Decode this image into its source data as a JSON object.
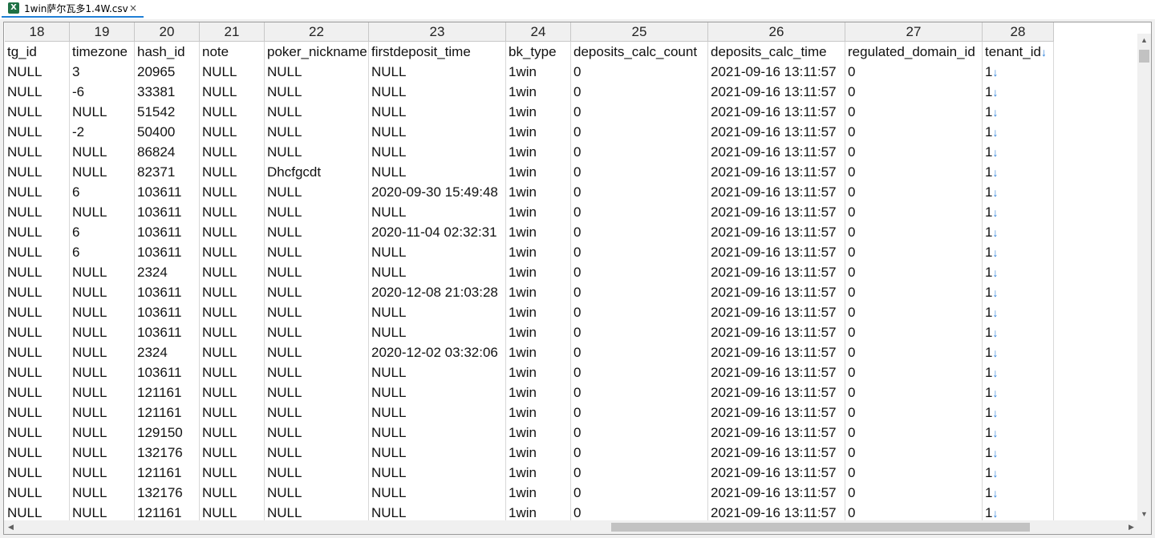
{
  "tab": {
    "title": "1win萨尔瓦多1.4W.csv",
    "close": "×",
    "icon_letter": "X",
    "icon": "excel-file-icon",
    "accent": "#1f7fd6"
  },
  "column_numbers": [
    "18",
    "19",
    "20",
    "21",
    "22",
    "23",
    "24",
    "25",
    "26",
    "27",
    "28"
  ],
  "headers": [
    "tg_id",
    "timezone",
    "hash_id",
    "note",
    "poker_nickname",
    "firstdeposit_time",
    "bk_type",
    "deposits_calc_count",
    "deposits_calc_time",
    "regulated_domain_id",
    "tenant_id"
  ],
  "rows": [
    [
      "NULL",
      "3",
      "20965",
      "NULL",
      "NULL",
      "NULL",
      "1win",
      "0",
      "2021-09-16 13:11:57",
      "0",
      "1"
    ],
    [
      "NULL",
      "-6",
      "33381",
      "NULL",
      "NULL",
      "NULL",
      "1win",
      "0",
      "2021-09-16 13:11:57",
      "0",
      "1"
    ],
    [
      "NULL",
      "NULL",
      "51542",
      "NULL",
      "NULL",
      "NULL",
      "1win",
      "0",
      "2021-09-16 13:11:57",
      "0",
      "1"
    ],
    [
      "NULL",
      "-2",
      "50400",
      "NULL",
      "NULL",
      "NULL",
      "1win",
      "0",
      "2021-09-16 13:11:57",
      "0",
      "1"
    ],
    [
      "NULL",
      "NULL",
      "86824",
      "NULL",
      "NULL",
      "NULL",
      "1win",
      "0",
      "2021-09-16 13:11:57",
      "0",
      "1"
    ],
    [
      "NULL",
      "NULL",
      "82371",
      "NULL",
      "Dhcfgcdt",
      "NULL",
      "1win",
      "0",
      "2021-09-16 13:11:57",
      "0",
      "1"
    ],
    [
      "NULL",
      "6",
      "103611",
      "NULL",
      "NULL",
      "2020-09-30 15:49:48",
      "1win",
      "0",
      "2021-09-16 13:11:57",
      "0",
      "1"
    ],
    [
      "NULL",
      "NULL",
      "103611",
      "NULL",
      "NULL",
      "NULL",
      "1win",
      "0",
      "2021-09-16 13:11:57",
      "0",
      "1"
    ],
    [
      "NULL",
      "6",
      "103611",
      "NULL",
      "NULL",
      "2020-11-04 02:32:31",
      "1win",
      "0",
      "2021-09-16 13:11:57",
      "0",
      "1"
    ],
    [
      "NULL",
      "6",
      "103611",
      "NULL",
      "NULL",
      "NULL",
      "1win",
      "0",
      "2021-09-16 13:11:57",
      "0",
      "1"
    ],
    [
      "NULL",
      "NULL",
      "2324",
      "NULL",
      "NULL",
      "NULL",
      "1win",
      "0",
      "2021-09-16 13:11:57",
      "0",
      "1"
    ],
    [
      "NULL",
      "NULL",
      "103611",
      "NULL",
      "NULL",
      "2020-12-08 21:03:28",
      "1win",
      "0",
      "2021-09-16 13:11:57",
      "0",
      "1"
    ],
    [
      "NULL",
      "NULL",
      "103611",
      "NULL",
      "NULL",
      "NULL",
      "1win",
      "0",
      "2021-09-16 13:11:57",
      "0",
      "1"
    ],
    [
      "NULL",
      "NULL",
      "103611",
      "NULL",
      "NULL",
      "NULL",
      "1win",
      "0",
      "2021-09-16 13:11:57",
      "0",
      "1"
    ],
    [
      "NULL",
      "NULL",
      "2324",
      "NULL",
      "NULL",
      "2020-12-02 03:32:06",
      "1win",
      "0",
      "2021-09-16 13:11:57",
      "0",
      "1"
    ],
    [
      "NULL",
      "NULL",
      "103611",
      "NULL",
      "NULL",
      "NULL",
      "1win",
      "0",
      "2021-09-16 13:11:57",
      "0",
      "1"
    ],
    [
      "NULL",
      "NULL",
      "121161",
      "NULL",
      "NULL",
      "NULL",
      "1win",
      "0",
      "2021-09-16 13:11:57",
      "0",
      "1"
    ],
    [
      "NULL",
      "NULL",
      "121161",
      "NULL",
      "NULL",
      "NULL",
      "1win",
      "0",
      "2021-09-16 13:11:57",
      "0",
      "1"
    ],
    [
      "NULL",
      "NULL",
      "129150",
      "NULL",
      "NULL",
      "NULL",
      "1win",
      "0",
      "2021-09-16 13:11:57",
      "0",
      "1"
    ],
    [
      "NULL",
      "NULL",
      "132176",
      "NULL",
      "NULL",
      "NULL",
      "1win",
      "0",
      "2021-09-16 13:11:57",
      "0",
      "1"
    ],
    [
      "NULL",
      "NULL",
      "121161",
      "NULL",
      "NULL",
      "NULL",
      "1win",
      "0",
      "2021-09-16 13:11:57",
      "0",
      "1"
    ],
    [
      "NULL",
      "NULL",
      "132176",
      "NULL",
      "NULL",
      "NULL",
      "1win",
      "0",
      "2021-09-16 13:11:57",
      "0",
      "1"
    ],
    [
      "NULL",
      "NULL",
      "121161",
      "NULL",
      "NULL",
      "NULL",
      "1win",
      "0",
      "2021-09-16 13:11:57",
      "0",
      "1"
    ]
  ],
  "line_break_marker": "↓",
  "scrollbars": {
    "up": "▲",
    "down": "▼",
    "left": "◀",
    "right": "▶"
  }
}
